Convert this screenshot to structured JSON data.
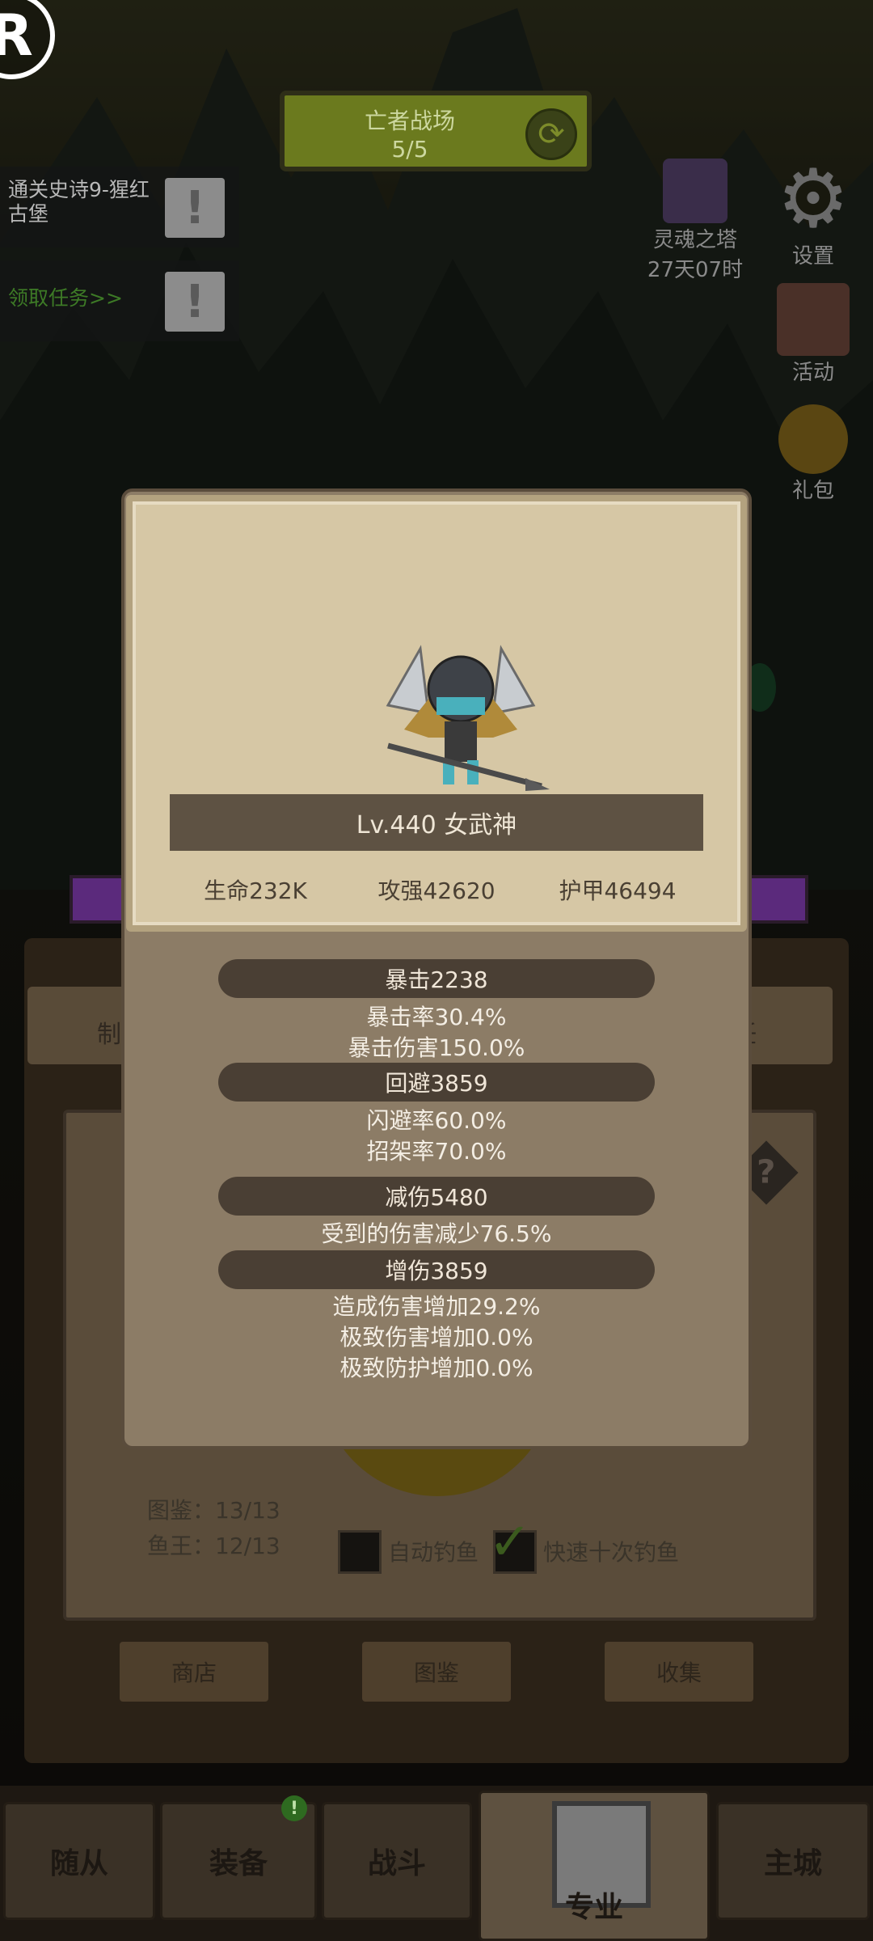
{
  "hud": {
    "logo_letter": "R",
    "zone_title": "亡者战场",
    "zone_progress": "5/5",
    "quests": [
      {
        "text": "通关史诗9-猩红古堡"
      },
      {
        "text": "领取任务>>"
      }
    ],
    "soul_tower": {
      "label": "灵魂之塔",
      "timer": "27天07时"
    },
    "settings": "设置",
    "events": "活动",
    "gift": "礼包"
  },
  "background": {
    "tab_left": "制",
    "tab_right": "任",
    "codex_line": "图鉴：13/13",
    "fishking_line": "鱼王：12/13",
    "auto_fishing": "自动钓鱼",
    "fast_ten": "快速十次钓鱼",
    "buttons": [
      "商店",
      "图鉴",
      "收集"
    ]
  },
  "nav": {
    "items": [
      "随从",
      "装备",
      "战斗",
      "专业",
      "主城"
    ],
    "active": "专业",
    "badge": "!"
  },
  "popup": {
    "title": "Lv.440 女武神",
    "base_stats": {
      "hp": "生命232K",
      "atk": "攻强42620",
      "armor": "护甲46494"
    },
    "groups": [
      {
        "header": "暴击2238",
        "lines": [
          "暴击率30.4%",
          "暴击伤害150.0%"
        ]
      },
      {
        "header": "回避3859",
        "lines": [
          "闪避率60.0%",
          "招架率70.0%"
        ]
      },
      {
        "header": "减伤5480",
        "lines": [
          "受到的伤害减少76.5%"
        ]
      },
      {
        "header": "增伤3859",
        "lines": [
          "造成伤害增加29.2%",
          "极致伤害增加0.0%",
          "极致防护增加0.0%"
        ]
      }
    ]
  }
}
